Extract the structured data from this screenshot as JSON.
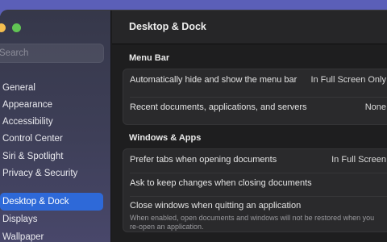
{
  "window": {
    "title": "Desktop & Dock"
  },
  "sidebar": {
    "search_placeholder": "Search",
    "items": [
      {
        "label": "General",
        "active": false
      },
      {
        "label": "Appearance",
        "active": false
      },
      {
        "label": "Accessibility",
        "active": false
      },
      {
        "label": "Control Center",
        "active": false
      },
      {
        "label": "Siri & Spotlight",
        "active": false
      },
      {
        "label": "Privacy & Security",
        "active": false
      },
      {
        "label": "Desktop & Dock",
        "active": true
      },
      {
        "label": "Displays",
        "active": false
      },
      {
        "label": "Wallpaper",
        "active": false
      }
    ]
  },
  "sections": {
    "menu_bar": {
      "title": "Menu Bar",
      "rows": [
        {
          "label": "Automatically hide and show the menu bar",
          "value": "In Full Screen Only"
        },
        {
          "label": "Recent documents, applications, and servers",
          "value": "None"
        }
      ]
    },
    "windows_apps": {
      "title": "Windows & Apps",
      "rows": [
        {
          "label": "Prefer tabs when opening documents",
          "value": "In Full Screen"
        },
        {
          "label": "Ask to keep changes when closing documents",
          "toggle": false
        },
        {
          "label": "Close windows when quitting an application",
          "toggle": true,
          "hint": "When enabled, open documents and windows will not be restored when you re-open an application."
        }
      ]
    }
  },
  "colors": {
    "accent": "#2e69d8",
    "toggle_on": "#2f73e0",
    "background": "#1e1e1f",
    "desktop": "#5b5fb8"
  }
}
